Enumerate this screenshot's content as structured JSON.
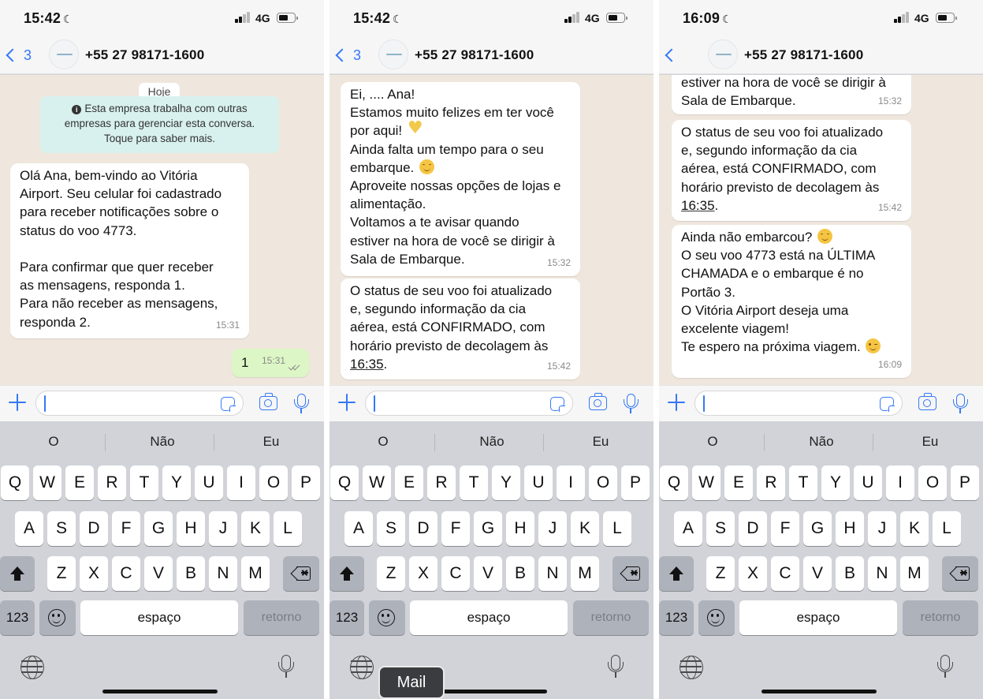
{
  "panels": [
    {
      "status": {
        "time": "15:42",
        "network": "4G"
      },
      "nav": {
        "back_count": "3",
        "contact": "+55 27 98171-1600"
      },
      "day_label": "Hoje",
      "notice": {
        "line1": "Esta empresa trabalha com outras",
        "line2": "empresas para gerenciar esta conversa.",
        "line3": "Toque para saber mais."
      },
      "messages": [
        {
          "lines": [
            "Olá Ana, bem-vindo ao Vitória",
            "Airport. Seu celular foi cadastrado",
            "para receber notificações sobre o",
            "status do voo 4773.",
            "",
            "Para confirmar que quer receber",
            "as mensagens, responda 1.",
            "Para não receber as mensagens,",
            "responda 2."
          ],
          "time": "15:31"
        },
        {
          "text": "1",
          "time": "15:31"
        }
      ]
    },
    {
      "status": {
        "time": "15:42",
        "network": "4G"
      },
      "nav": {
        "back_count": "3",
        "contact": "+55 27 98171-1600"
      },
      "messages": [
        {
          "lines": [
            "Ei, .... Ana!",
            "Estamos muito felizes em ter você",
            "por aqui!",
            "Ainda falta um tempo para o seu",
            "embarque.",
            "Aproveite nossas opções de lojas e",
            "alimentação.",
            "Voltamos a te avisar quando",
            "estiver na hora de você se dirigir à",
            "Sala de Embarque."
          ],
          "time": "15:32"
        },
        {
          "lines": [
            "O status de seu voo foi atualizado",
            "e, segundo informação da cia",
            "aérea, está CONFIRMADO, com",
            "horário previsto de decolagem às",
            "16:35",
            "."
          ],
          "time": "15:42"
        }
      ],
      "tooltip": "Mail"
    },
    {
      "status": {
        "time": "16:09",
        "network": "4G"
      },
      "nav": {
        "contact": "+55 27 98171-1600"
      },
      "messages": [
        {
          "lines": [
            "estiver na hora de você se dirigir à",
            "Sala de Embarque."
          ],
          "time": "15:32"
        },
        {
          "lines": [
            "O status de seu voo foi atualizado",
            "e, segundo informação da cia",
            "aérea, está CONFIRMADO, com",
            "horário previsto de decolagem às",
            "16:35",
            "."
          ],
          "time": "15:42"
        },
        {
          "lines": [
            "Ainda não embarcou?",
            "O seu voo 4773 está na ÚLTIMA",
            "CHAMADA e o embarque é no",
            "Portão 3.",
            "O Vitória Airport deseja uma",
            "excelente viagem!",
            "Te espero na próxima viagem."
          ],
          "time": "16:09"
        }
      ]
    }
  ],
  "keyboard": {
    "suggestions": [
      "O",
      "Não",
      "Eu"
    ],
    "row1": [
      "Q",
      "W",
      "E",
      "R",
      "T",
      "Y",
      "U",
      "I",
      "O",
      "P"
    ],
    "row2": [
      "A",
      "S",
      "D",
      "F",
      "G",
      "H",
      "J",
      "K",
      "L"
    ],
    "row3": [
      "Z",
      "X",
      "C",
      "V",
      "B",
      "N",
      "M"
    ],
    "numbers_label": "123",
    "space_label": "espaço",
    "return_label": "retorno"
  },
  "colors": {
    "accent": "#3478f6",
    "incoming_bubble": "#ffffff",
    "outgoing_bubble": "#dcf7c5",
    "chat_bg": "#efe7dd",
    "notice_bg": "#d8f1ee",
    "keyboard_bg": "#d1d3d9"
  },
  "icons": [
    "moon-icon",
    "signal-icon",
    "battery-icon",
    "back-chevron-icon",
    "plus-icon",
    "sticker-icon",
    "camera-icon",
    "mic-icon",
    "shift-icon",
    "backspace-icon",
    "emoji-icon",
    "globe-icon",
    "dictation-icon",
    "read-receipt-icon",
    "info-icon"
  ]
}
